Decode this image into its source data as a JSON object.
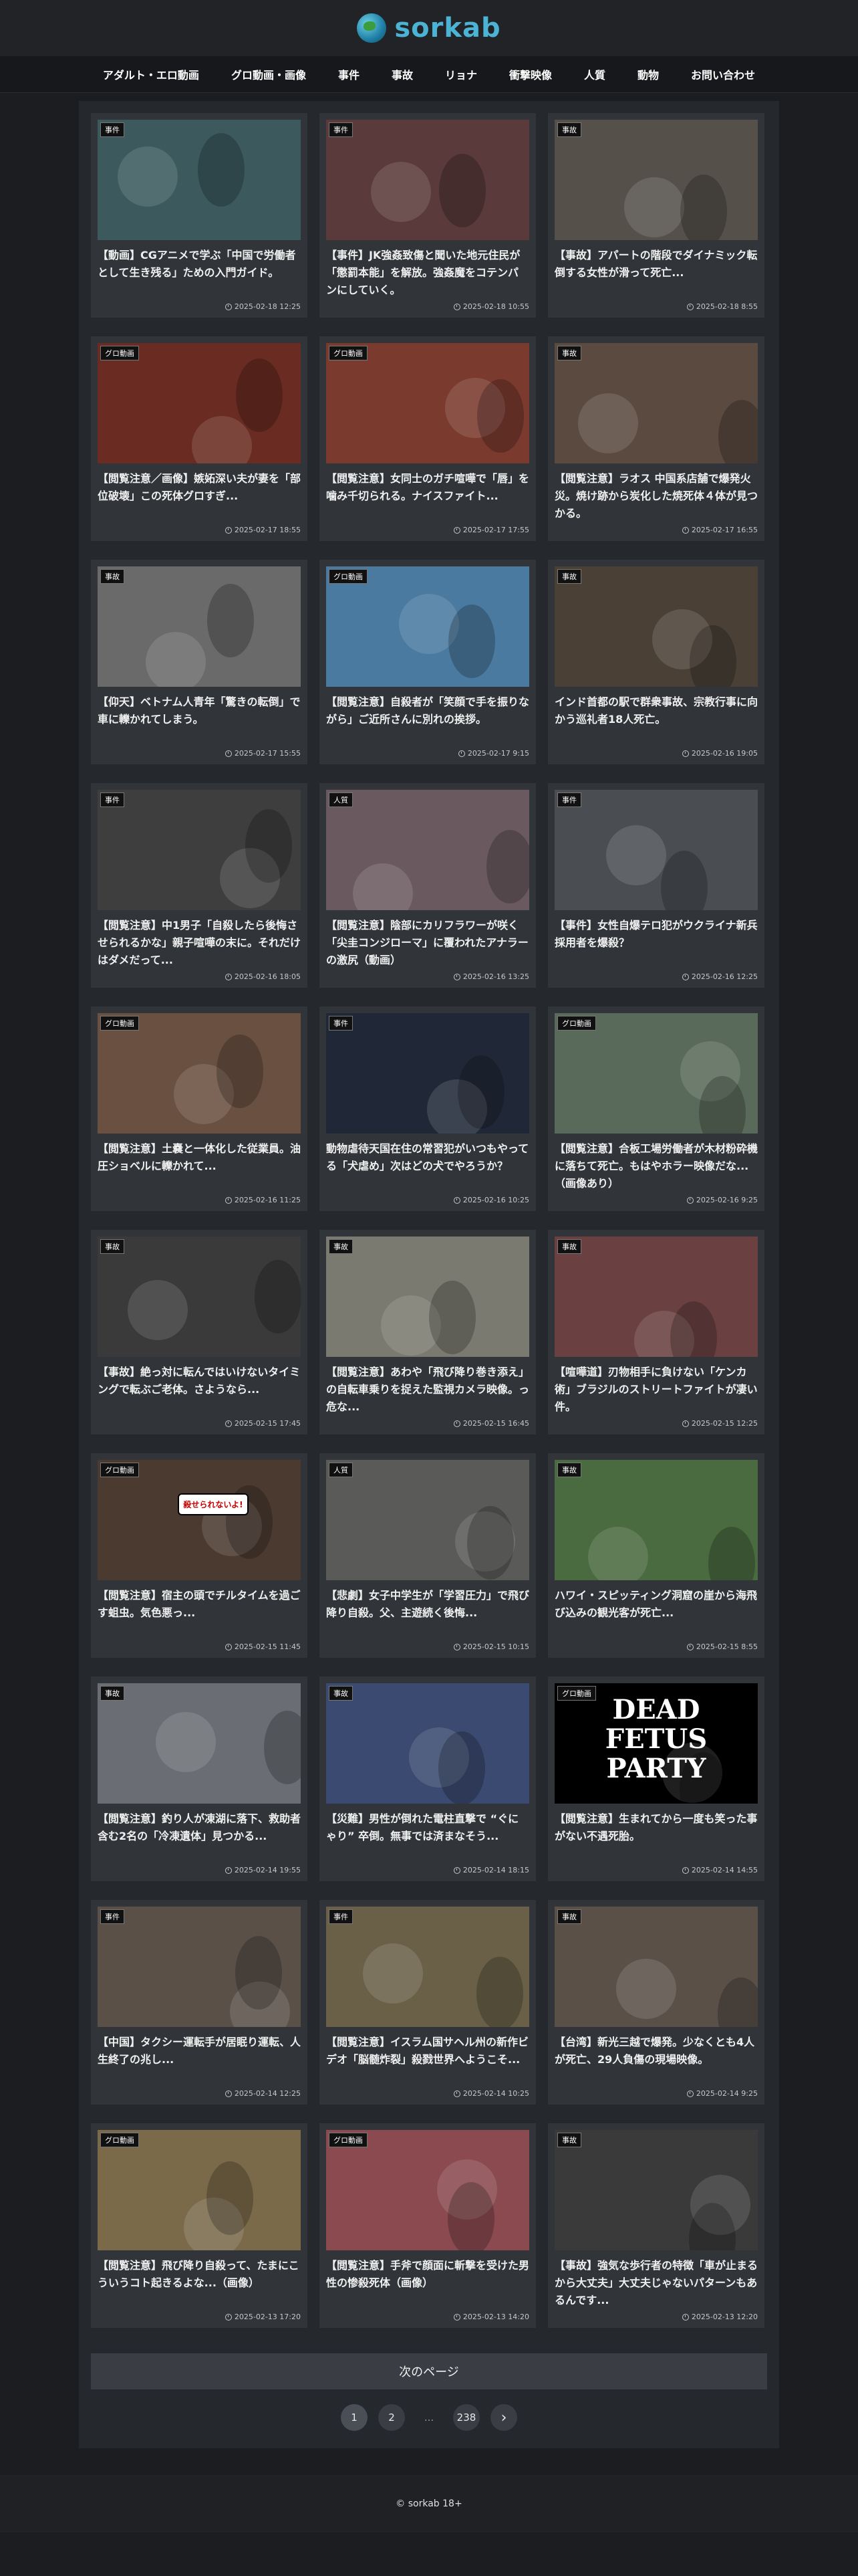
{
  "site": {
    "logo_text": "sorkab"
  },
  "nav": [
    "アダルト・エロ動画",
    "グロ動画・画像",
    "事件",
    "事故",
    "リョナ",
    "衝撃映像",
    "人質",
    "動物",
    "お問い合わせ"
  ],
  "posts": [
    {
      "category": "事件",
      "title": "【動画】CGアニメで学ぶ「中国で労働者として生き残る」ための入門ガイド。",
      "date": "2025-02-18 12:25",
      "bg": "#3c5a5e"
    },
    {
      "category": "事件",
      "title": "【事件】JK強姦致傷と聞いた地元住民が「懲罰本能」を解放。強姦魔をコテンパンにしていく。",
      "date": "2025-02-18 10:55",
      "bg": "#5a3a3a"
    },
    {
      "category": "事故",
      "title": "【事故】アパートの階段でダイナミック転倒する女性が滑って死亡...",
      "date": "2025-02-18 8:55",
      "bg": "#55504a"
    },
    {
      "category": "グロ動画",
      "title": "【閲覧注意／画像】嫉妬深い夫が妻を「部位破壊」この死体グロすぎ...",
      "date": "2025-02-17 18:55",
      "bg": "#6a2c22"
    },
    {
      "category": "グロ動画",
      "title": "【閲覧注意】女同士のガチ喧嘩で「唇」を噛み千切られる。ナイスファイト...",
      "date": "2025-02-17 17:55",
      "bg": "#7a3a2e"
    },
    {
      "category": "事故",
      "title": "【閲覧注意】ラオス 中国系店舗で爆発火災。焼け跡から炭化した焼死体４体が見つかる。",
      "date": "2025-02-17 16:55",
      "bg": "#5a4a40"
    },
    {
      "category": "事故",
      "title": "【仰天】ベトナム人青年「驚きの転倒」で車に轢かれてしまう。",
      "date": "2025-02-17 15:55",
      "bg": "#6a6a6a"
    },
    {
      "category": "グロ動画",
      "title": "【閲覧注意】自殺者が「笑顔で手を振りながら」ご近所さんに別れの挨拶。",
      "date": "2025-02-17 9:15",
      "bg": "#4a7aa0"
    },
    {
      "category": "事故",
      "title": "インド首都の駅で群衆事故、宗教行事に向かう巡礼者18人死亡。",
      "date": "2025-02-16 19:05",
      "bg": "#4a4036"
    },
    {
      "category": "事件",
      "title": "【閲覧注意】中1男子「自殺したら後悔させられるかな」親子喧嘩の末に。それだけはダメだって...",
      "date": "2025-02-16 18:05",
      "bg": "#3e3e3e"
    },
    {
      "category": "人質",
      "title": "【閲覧注意】陰部にカリフラワーが咲く「尖圭コンジローマ」に覆われたアナラーの激尻（動画）",
      "date": "2025-02-16 13:25",
      "bg": "#6a5a60"
    },
    {
      "category": "事件",
      "title": "【事件】女性自爆テロ犯がウクライナ新兵採用者を爆殺？",
      "date": "2025-02-16 12:25",
      "bg": "#4a4e52"
    },
    {
      "category": "グロ動画",
      "title": "【閲覧注意】土嚢と一体化した従業員。油圧ショベルに轢かれて...",
      "date": "2025-02-16 11:25",
      "bg": "#6a5040"
    },
    {
      "category": "事件",
      "title": "動物虐待天国在住の常習犯がいつもやってる「犬虐め」次はどの犬でやろうか？",
      "date": "2025-02-16 10:25",
      "bg": "#202838"
    },
    {
      "category": "グロ動画",
      "title": "【閲覧注意】合板工場労働者が木材粉砕機に落ちて死亡。もはやホラー映像だな...（画像あり）",
      "date": "2025-02-16 9:25",
      "bg": "#5a6a5a"
    },
    {
      "category": "事故",
      "title": "【事故】絶っ対に転んではいけないタイミングで転ぶご老体。さようなら...",
      "date": "2025-02-15 17:45",
      "bg": "#3a3a3a"
    },
    {
      "category": "事故",
      "title": "【閲覧注意】あわや「飛び降り巻き添え」の自転車乗りを捉えた監視カメラ映像。っ危な...",
      "date": "2025-02-15 16:45",
      "bg": "#7a7a70"
    },
    {
      "category": "事故",
      "title": "【喧嘩道】刃物相手に負けない「ケンカ術」ブラジルのストリートファイトが凄い件。",
      "date": "2025-02-15 12:25",
      "bg": "#6a4040"
    },
    {
      "category": "グロ動画",
      "title": "【閲覧注意】宿主の頭でチルタイムを過ごす蛆虫。気色悪っ...",
      "date": "2025-02-15 11:45",
      "bg": "#4a3a30"
    },
    {
      "category": "人質",
      "title": "【悲劇】女子中学生が「学習圧力」で飛び降り自殺。父、主遊続く後悔...",
      "date": "2025-02-15 10:15",
      "bg": "#5a5a58"
    },
    {
      "category": "事故",
      "title": "ハワイ・スピッティング洞窟の崖から海飛び込みの観光客が死亡...",
      "date": "2025-02-15 8:55",
      "bg": "#4a6a40"
    },
    {
      "category": "事故",
      "title": "【閲覧注意】釣り人が凍湖に落下、救助者含む2名の「冷凍遺体」見つかる...",
      "date": "2025-02-14 19:55",
      "bg": "#6a6e74"
    },
    {
      "category": "事故",
      "title": "【災難】男性が倒れた電柱直撃で “ぐにゃり” 卒倒。無事では済まなそう...",
      "date": "2025-02-14 18:15",
      "bg": "#3a4a70"
    },
    {
      "category": "グロ動画",
      "title": "【閲覧注意】生まれてから一度も笑った事がない不遇死胎。",
      "date": "2025-02-14 14:55",
      "bg": "#000000"
    },
    {
      "category": "事件",
      "title": "【中国】タクシー運転手が居眠り運転、人生終了の兆し...",
      "date": "2025-02-14 12:25",
      "bg": "#5a5048"
    },
    {
      "category": "事件",
      "title": "【閲覧注意】イスラム国サヘル州の新作ビデオ「脳髄炸裂」殺戮世界へようこそ...",
      "date": "2025-02-14 10:25",
      "bg": "#6a6048"
    },
    {
      "category": "事故",
      "title": "【台湾】新光三越で爆発。少なくとも4人が死亡、29人負傷の現場映像。",
      "date": "2025-02-14 9:25",
      "bg": "#5a5048"
    },
    {
      "category": "グロ動画",
      "title": "【閲覧注意】飛び降り自殺って、たまにこういうコト起きるよな...（画像）",
      "date": "2025-02-13 17:20",
      "bg": "#7a6a4a"
    },
    {
      "category": "グロ動画",
      "title": "【閲覧注意】手斧で顔面に斬撃を受けた男性の惨殺死体（画像）",
      "date": "2025-02-13 14:20",
      "bg": "#8a4a50"
    },
    {
      "category": "事故",
      "title": "【事故】強気な歩行者の特徴「車が止まるから大丈夫」大丈夫じゃないパターンもあるんです...",
      "date": "2025-02-13 12:20",
      "bg": "#3a3a3a"
    }
  ],
  "thumb_texts": {
    "dead_fetus": "DEAD\nFETUS\nPARTY",
    "speech": "殺せられないよ!"
  },
  "pagination": {
    "next_label": "次のページ",
    "pages": [
      "1",
      "2",
      "...",
      "238"
    ],
    "next_icon": "chevron-right-icon"
  },
  "footer": {
    "copyright": "© sorkab 18+"
  }
}
